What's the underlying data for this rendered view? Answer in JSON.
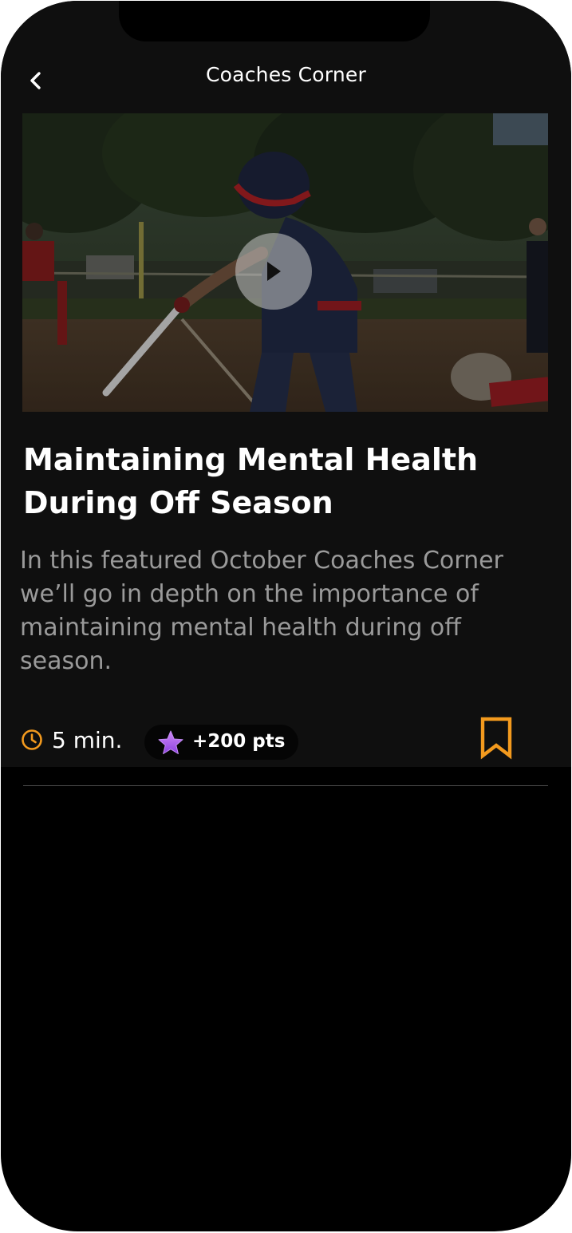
{
  "header": {
    "title": "Coaches Corner",
    "back_icon": "chevron-left-icon"
  },
  "video": {
    "play_icon": "play-icon",
    "alt": "softball batter swinging"
  },
  "article": {
    "title": "Maintaining Mental Health During Off Season",
    "description": "In this featured October Coaches Corner we’ll go in depth on the importance of maintaining mental health during off season."
  },
  "meta": {
    "duration": "5 min.",
    "points": "+200 pts",
    "clock_icon": "clock-icon",
    "star_icon": "star-icon",
    "bookmark_icon": "bookmark-icon"
  },
  "colors": {
    "accent": "#f39a1e",
    "background": "#0f0f0f",
    "star": "#b36ef0"
  }
}
